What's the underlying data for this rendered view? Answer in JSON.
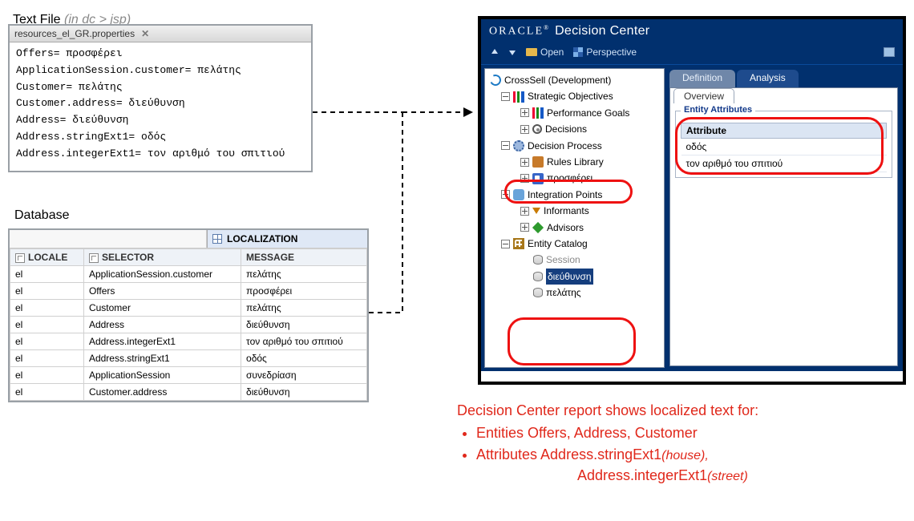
{
  "textfile": {
    "heading": "Text File ",
    "heading_loc": "(in dc > jsp)",
    "tab_name": "resources_el_GR.properties",
    "lines": [
      "Offers= προσφέρει",
      "ApplicationSession.customer= πελάτης",
      "Customer= πελάτης",
      "Customer.address= διεύθυνση",
      "Address= διεύθυνση",
      "Address.stringExt1= οδός",
      "Address.integerExt1= τον αριθμό του σπιτιού"
    ]
  },
  "database": {
    "heading": "Database",
    "table_title": "LOCALIZATION",
    "columns": [
      "LOCALE",
      "SELECTOR",
      "MESSAGE"
    ],
    "rows": [
      {
        "locale": "el",
        "selector": "ApplicationSession.customer",
        "message": "πελάτης"
      },
      {
        "locale": "el",
        "selector": "Offers",
        "message": "προσφέρει"
      },
      {
        "locale": "el",
        "selector": "Customer",
        "message": "πελάτης"
      },
      {
        "locale": "el",
        "selector": "Address",
        "message": "διεύθυνση"
      },
      {
        "locale": "el",
        "selector": "Address.integerExt1",
        "message": "τον αριθμό του σπιτιού"
      },
      {
        "locale": "el",
        "selector": "Address.stringExt1",
        "message": "οδός"
      },
      {
        "locale": "el",
        "selector": "ApplicationSession",
        "message": "συνεδρίαση"
      },
      {
        "locale": "el",
        "selector": "Customer.address",
        "message": "διεύθυνση"
      }
    ]
  },
  "dc": {
    "brand": "ORACLE",
    "app_title": "Decision Center",
    "toolbar": {
      "open": "Open",
      "perspective": "Perspective"
    },
    "tree": {
      "root": "CrossSell (Development)",
      "strategic": "Strategic Objectives",
      "perf": "Performance Goals",
      "decisions": "Decisions",
      "process": "Decision Process",
      "rules": "Rules Library",
      "offers_local": "προσφέρει",
      "integration": "Integration Points",
      "informants": "Informants",
      "advisors": "Advisors",
      "catalog": "Entity Catalog",
      "session": "Session",
      "addr_local": "διεύθυνση",
      "cust_local": "πελάτης"
    },
    "tabs": {
      "definition": "Definition",
      "analysis": "Analysis",
      "overview": "Overview"
    },
    "group_title": "Entity Attributes",
    "attr_header": "Attribute",
    "attr_rows": [
      "οδός",
      "τον αριθμό του σπιτιού"
    ]
  },
  "annotation": {
    "line1": "Decision Center report shows localized text for:",
    "bullet1a": "Entities Offers, Address, Customer",
    "bullet2a": "Attributes Address.stringExt1",
    "bullet2a_i": "(house),",
    "bullet2b": "Address.integerExt1",
    "bullet2b_i": "(street)"
  }
}
